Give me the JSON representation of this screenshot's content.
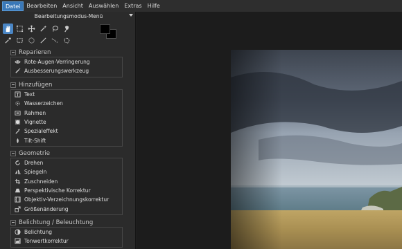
{
  "menubar": {
    "items": [
      "Datei",
      "Bearbeiten",
      "Ansicht",
      "Auswählen",
      "Extras",
      "Hilfe"
    ],
    "active": "Datei"
  },
  "panel": {
    "mode_title": "Bearbeitungsmodus-Menü",
    "tools_row1": [
      "hand-icon",
      "crop-select-icon",
      "move-icon",
      "magic-wand-icon",
      "lasso-icon",
      "brush-select-icon"
    ],
    "tools_row2": [
      "eyedropper-icon",
      "rect-select-icon",
      "ellipse-select-icon",
      "line-icon",
      "freehand-icon",
      "polygon-select-icon"
    ],
    "foreground_color": "#000000",
    "background_color": "#000000",
    "sections": [
      {
        "title": "Reparieren",
        "items": [
          {
            "label": "Rote-Augen-Verringerung",
            "icon": "eye-icon"
          },
          {
            "label": "Ausbesserungswerkzeug",
            "icon": "patch-icon"
          }
        ]
      },
      {
        "title": "Hinzufügen",
        "items": [
          {
            "label": "Text",
            "icon": "text-icon"
          },
          {
            "label": "Wasserzeichen",
            "icon": "watermark-icon"
          },
          {
            "label": "Rahmen",
            "icon": "frame-icon"
          },
          {
            "label": "Vignette",
            "icon": "vignette-icon"
          },
          {
            "label": "Spezialeffekt",
            "icon": "effect-icon"
          },
          {
            "label": "Tilt-Shift",
            "icon": "tilt-shift-icon"
          }
        ]
      },
      {
        "title": "Geometrie",
        "items": [
          {
            "label": "Drehen",
            "icon": "rotate-icon"
          },
          {
            "label": "Spiegeln",
            "icon": "mirror-icon"
          },
          {
            "label": "Zuschneiden",
            "icon": "crop-icon"
          },
          {
            "label": "Perspektivische Korrektur",
            "icon": "perspective-icon"
          },
          {
            "label": "Objektiv-Verzeichnungskorrektur",
            "icon": "lens-icon"
          },
          {
            "label": "Größenänderung",
            "icon": "resize-icon"
          }
        ]
      },
      {
        "title": "Belichtung / Beleuchtung",
        "items": [
          {
            "label": "Belichtung",
            "icon": "exposure-icon"
          },
          {
            "label": "Tonwertkorrektur",
            "icon": "levels-icon"
          }
        ]
      }
    ]
  }
}
